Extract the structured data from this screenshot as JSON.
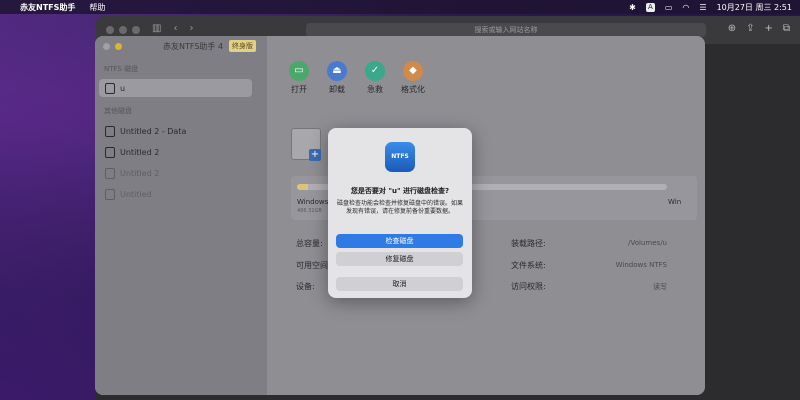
{
  "menubar": {
    "app_name": "赤友NTFS助手",
    "menu_help": "帮助",
    "datetime": "10月27日 周三 2:51",
    "input_indicator": "A"
  },
  "browser": {
    "address_placeholder": "搜索或输入网站名称"
  },
  "app": {
    "title": "赤友NTFS助手 4",
    "edition_badge": "终身版",
    "sidebar": {
      "section_ntfs": "NTFS 磁盘",
      "ntfs_items": [
        {
          "label": "u"
        }
      ],
      "section_other": "其他磁盘",
      "other_items": [
        {
          "label": "Untitled 2 - Data"
        },
        {
          "label": "Untitled 2"
        },
        {
          "label": "Untitled 2"
        },
        {
          "label": "Untitled"
        }
      ]
    },
    "toolbar": {
      "open": "打开",
      "unmount": "卸载",
      "rescue": "急救",
      "format": "格式化"
    },
    "usage": {
      "name": "Windows",
      "sub": "486.31GB",
      "right": "Win",
      "fill_fraction": 0.03
    },
    "info": {
      "total_label": "总容量:",
      "available_label": "可用空间",
      "device_label": "设备:",
      "mount_label": "装载路径:",
      "mount_value": "/Volumes/u",
      "fs_label": "文件系统:",
      "fs_value": "Windows NTFS",
      "access_label": "访问权限:",
      "access_value": "读写"
    }
  },
  "dialog": {
    "icon_text": "NTFS",
    "title": "您是否要对 \"u\" 进行磁盘检查?",
    "message": "磁盘检查功能会检查并修复磁盘中的错误。如果发现有错误，请在修复前备份重要数据。",
    "check_button": "检查磁盘",
    "repair_button": "修复磁盘",
    "cancel_button": "取消"
  }
}
